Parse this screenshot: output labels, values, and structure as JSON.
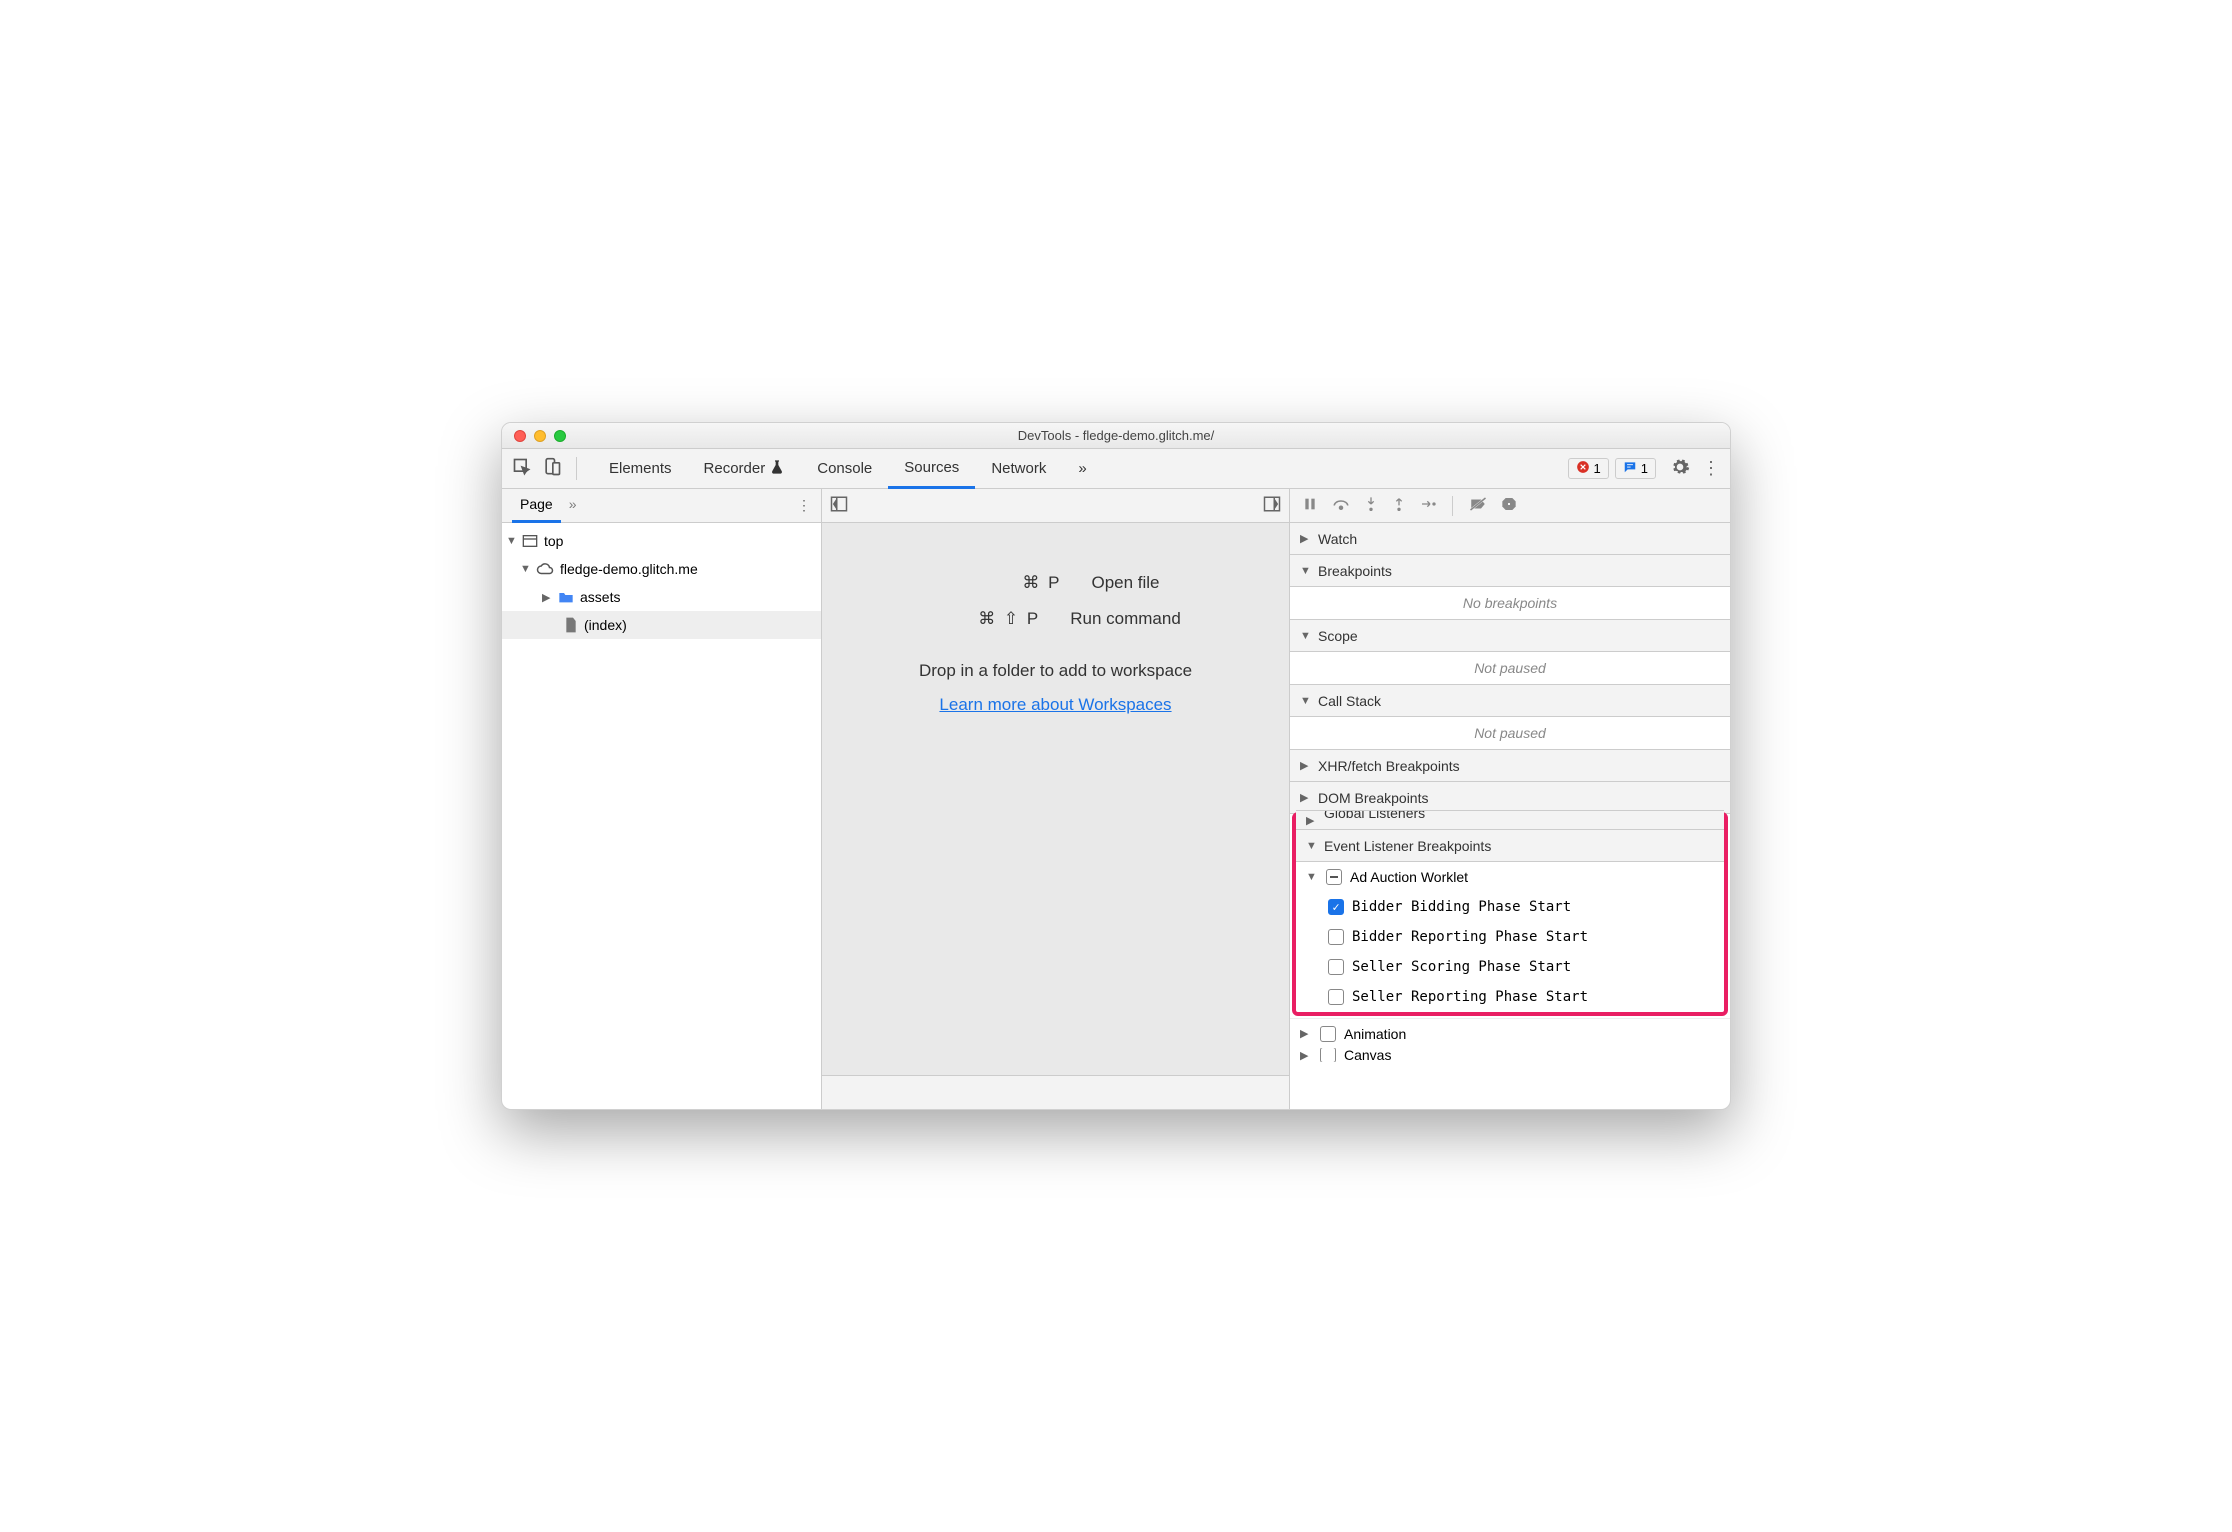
{
  "title": "DevTools - fledge-demo.glitch.me/",
  "main_tabs": {
    "elements": "Elements",
    "recorder": "Recorder",
    "console": "Console",
    "sources": "Sources",
    "network": "Network"
  },
  "badges": {
    "errors": "1",
    "messages": "1"
  },
  "left": {
    "tabs": {
      "page": "Page"
    },
    "tree": {
      "top": "top",
      "origin": "fledge-demo.glitch.me",
      "assets": "assets",
      "index": "(index)"
    }
  },
  "mid": {
    "open_keys": "⌘ P",
    "open_label": "Open file",
    "run_keys": "⌘ ⇧ P",
    "run_label": "Run command",
    "hint": "Drop in a folder to add to workspace",
    "link": "Learn more about Workspaces"
  },
  "right": {
    "sections": {
      "watch": "Watch",
      "breakpoints": "Breakpoints",
      "no_breakpoints": "No breakpoints",
      "scope": "Scope",
      "not_paused1": "Not paused",
      "callstack": "Call Stack",
      "not_paused2": "Not paused",
      "xhr": "XHR/fetch Breakpoints",
      "dom": "DOM Breakpoints",
      "global": "Global Listeners",
      "elb": "Event Listener Breakpoints",
      "animation": "Animation",
      "canvas": "Canvas"
    },
    "auction": {
      "group": "Ad Auction Worklet",
      "items": [
        "Bidder Bidding Phase Start",
        "Bidder Reporting Phase Start",
        "Seller Scoring Phase Start",
        "Seller Reporting Phase Start"
      ]
    }
  }
}
